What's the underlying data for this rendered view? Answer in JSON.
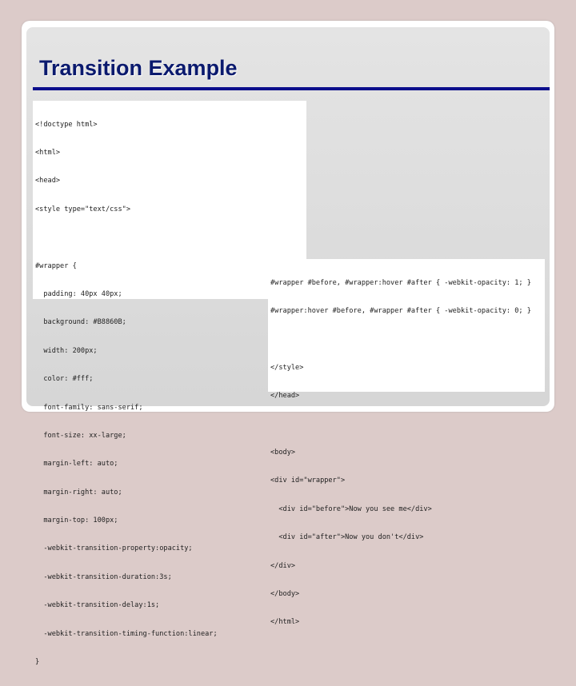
{
  "slide": {
    "title": "Transition Example"
  },
  "code_block_1": {
    "lines": [
      "<!doctype html>",
      "<html>",
      "<head>",
      "<style type=\"text/css\">",
      "",
      "#wrapper {",
      "  padding: 40px 40px;",
      "  background: #B8860B;",
      "  width: 200px;",
      "  color: #fff;",
      "  font-family: sans-serif;",
      "  font-size: xx-large;",
      "  margin-left: auto;",
      "  margin-right: auto;",
      "  margin-top: 100px;",
      "  -webkit-transition-property:opacity;",
      "  -webkit-transition-duration:3s;",
      "  -webkit-transition-delay:1s;",
      "  -webkit-transition-timing-function:linear;",
      "}"
    ]
  },
  "code_block_2": {
    "lines": [
      "#wrapper #before, #wrapper:hover #after { -webkit-opacity: 1; }",
      "#wrapper:hover #before, #wrapper #after { -webkit-opacity: 0; }",
      "",
      "</style>",
      "</head>",
      "",
      "<body>",
      "<div id=\"wrapper\">",
      "  <div id=\"before\">Now you see me</div>",
      "  <div id=\"after\">Now you don't</div>",
      "</div>",
      "</body>",
      "</html>"
    ]
  },
  "colors": {
    "title": "#0b1a6e",
    "rule": "#0c0e8c",
    "background": "#dccbc9"
  }
}
